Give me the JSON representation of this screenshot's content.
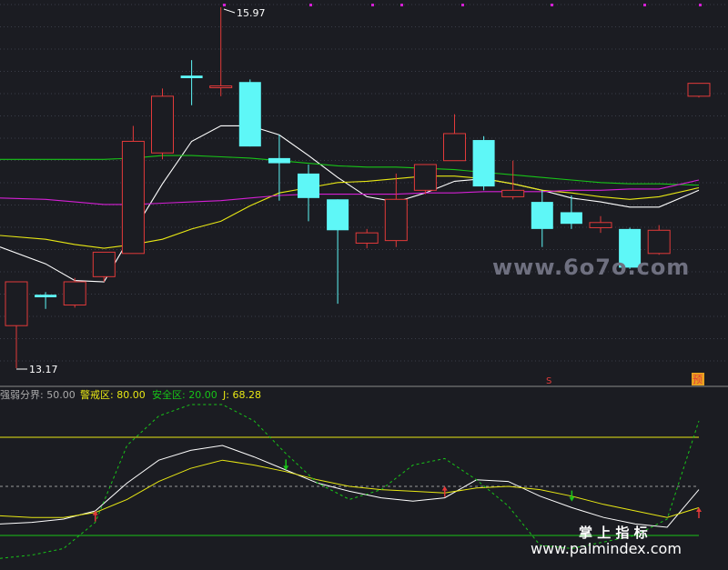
{
  "colors": {
    "background": "#1b1c22",
    "grid": "#3a3d48",
    "divider": "#8a8a8a",
    "up": "#e23a3a",
    "down": "#5ef7f7",
    "ma_white": "#ffffff",
    "ma_yellow": "#e8e814",
    "ma_green": "#18c418",
    "ma_magenta": "#d420d4",
    "osc_white": "#ffffff",
    "osc_yellow": "#e8e814",
    "osc_green_dash": "#18c418",
    "level_warning": "#e8e814",
    "level_safe": "#18c418",
    "level_mid": "#9a9a9a",
    "watermark": "#6f7080",
    "brand": "#ffffff"
  },
  "watermarks": {
    "center": "www.6o7o.com",
    "brand_cn": "掌 上 指 标",
    "brand_url": "www.palmindex.com"
  },
  "chart_data": [
    {
      "type": "candlestick",
      "title": "",
      "ylim": [
        13.0,
        16.0
      ],
      "annotations": {
        "high_label": "15.97",
        "low_label": "13.17"
      },
      "markers": {
        "signal": "S",
        "forecast": "预"
      },
      "candles": [
        {
          "o": 13.5,
          "h": 13.55,
          "l": 13.17,
          "c": 13.84
        },
        {
          "o": 13.74,
          "h": 13.76,
          "l": 13.63,
          "c": 13.72
        },
        {
          "o": 13.66,
          "h": 13.87,
          "l": 13.64,
          "c": 13.84
        },
        {
          "o": 13.88,
          "h": 14.03,
          "l": 13.84,
          "c": 14.07
        },
        {
          "o": 14.06,
          "h": 15.05,
          "l": 14.09,
          "c": 14.93
        },
        {
          "o": 14.84,
          "h": 15.34,
          "l": 14.79,
          "c": 15.28
        },
        {
          "o": 15.44,
          "h": 15.56,
          "l": 15.21,
          "c": 15.42
        },
        {
          "o": 15.36,
          "h": 15.97,
          "l": 15.28,
          "c": 15.36
        },
        {
          "o": 15.39,
          "h": 15.41,
          "l": 14.89,
          "c": 14.89
        },
        {
          "o": 14.8,
          "h": 14.98,
          "l": 14.47,
          "c": 14.76
        },
        {
          "o": 14.68,
          "h": 14.75,
          "l": 14.31,
          "c": 14.49
        },
        {
          "o": 14.48,
          "h": 14.48,
          "l": 13.67,
          "c": 14.24
        },
        {
          "o": 14.14,
          "h": 14.25,
          "l": 14.1,
          "c": 14.22
        },
        {
          "o": 14.16,
          "h": 14.68,
          "l": 14.11,
          "c": 14.48
        },
        {
          "o": 14.55,
          "h": 14.68,
          "l": 14.52,
          "c": 14.75
        },
        {
          "o": 14.78,
          "h": 15.14,
          "l": 14.8,
          "c": 14.99
        },
        {
          "o": 14.94,
          "h": 14.97,
          "l": 14.55,
          "c": 14.58
        },
        {
          "o": 14.5,
          "h": 14.78,
          "l": 14.48,
          "c": 14.55
        },
        {
          "o": 14.46,
          "h": 14.55,
          "l": 14.11,
          "c": 14.25
        },
        {
          "o": 14.38,
          "h": 14.51,
          "l": 14.25,
          "c": 14.29
        },
        {
          "o": 14.26,
          "h": 14.35,
          "l": 14.22,
          "c": 14.3
        },
        {
          "o": 14.25,
          "h": 14.26,
          "l": 13.94,
          "c": 13.95
        },
        {
          "o": 14.06,
          "h": 14.28,
          "l": 14.05,
          "c": 14.24
        },
        {
          "o": 15.28,
          "h": 15.38,
          "l": 15.27,
          "c": 15.38
        }
      ],
      "series": [
        {
          "color": "white",
          "values": [
            14.11,
            13.98,
            13.85,
            13.84,
            14.23,
            14.6,
            14.93,
            15.05,
            15.05,
            14.98,
            14.82,
            14.65,
            14.5,
            14.46,
            14.53,
            14.62,
            14.64,
            14.6,
            14.55,
            14.49,
            14.46,
            14.42,
            14.42,
            14.55
          ]
        },
        {
          "color": "yellow",
          "values": [
            14.2,
            14.17,
            14.13,
            14.1,
            14.13,
            14.17,
            14.25,
            14.31,
            14.43,
            14.53,
            14.57,
            14.61,
            14.62,
            14.64,
            14.66,
            14.66,
            14.64,
            14.6,
            14.55,
            14.53,
            14.5,
            14.48,
            14.5,
            14.57
          ]
        },
        {
          "color": "green",
          "values": [
            14.79,
            14.79,
            14.79,
            14.79,
            14.8,
            14.82,
            14.82,
            14.81,
            14.8,
            14.78,
            14.76,
            14.74,
            14.73,
            14.73,
            14.72,
            14.71,
            14.69,
            14.67,
            14.65,
            14.63,
            14.61,
            14.6,
            14.6,
            14.59
          ]
        },
        {
          "color": "magenta",
          "values": [
            14.49,
            14.48,
            14.46,
            14.44,
            14.44,
            14.45,
            14.46,
            14.47,
            14.49,
            14.51,
            14.52,
            14.52,
            14.52,
            14.52,
            14.53,
            14.53,
            14.54,
            14.54,
            14.54,
            14.55,
            14.55,
            14.56,
            14.56,
            14.63
          ]
        }
      ]
    },
    {
      "type": "line",
      "title": "",
      "ylim": [
        0,
        100
      ],
      "legend": [
        {
          "label": "强弱分界: 50.00",
          "color": "#aaaaaa"
        },
        {
          "label": "警戒区: 80.00",
          "color": "#e8e814"
        },
        {
          "label": "安全区: 20.00",
          "color": "#18c418"
        },
        {
          "label": "J: 68.28",
          "color": "#e8e814"
        }
      ],
      "levels": {
        "warning": 80,
        "mid": 50,
        "safe": 20
      },
      "series": [
        {
          "name": "",
          "style": "white",
          "values": [
            27,
            28,
            30,
            35,
            52,
            66,
            72,
            75,
            68,
            60,
            52,
            47,
            43,
            41,
            43,
            54,
            53,
            44,
            37,
            31,
            27,
            25,
            48
          ]
        },
        {
          "name": "",
          "style": "yellow",
          "values": [
            32,
            31,
            31,
            34,
            42,
            53,
            61,
            66,
            63,
            59,
            54,
            50,
            48,
            47,
            46,
            49,
            50,
            48,
            44,
            39,
            35,
            31,
            37
          ]
        },
        {
          "name": "",
          "style": "green-dash",
          "values": [
            6,
            8,
            12,
            28,
            75,
            93,
            101,
            104,
            90,
            70,
            52,
            42,
            48,
            63,
            67,
            54,
            38,
            14,
            12,
            16,
            20,
            30,
            90
          ]
        }
      ],
      "signals": [
        {
          "type": "up",
          "index": 3,
          "value": 33
        },
        {
          "type": "down",
          "index": 9,
          "value": 62
        },
        {
          "type": "up",
          "index": 14,
          "value": 48
        },
        {
          "type": "down",
          "index": 18,
          "value": 43
        },
        {
          "type": "up",
          "index": 22,
          "value": 35
        }
      ]
    }
  ]
}
